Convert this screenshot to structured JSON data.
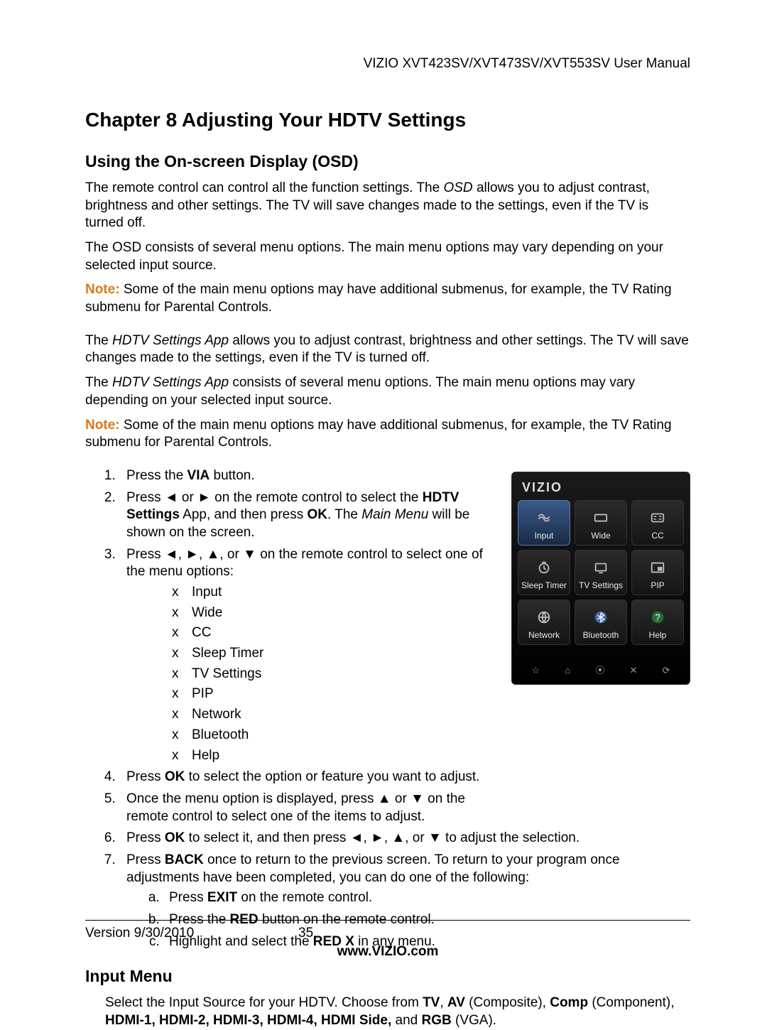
{
  "header": {
    "product_line": "VIZIO XVT423SV/XVT473SV/XVT553SV User Manual"
  },
  "chapter": {
    "number": "Chapter 8",
    "title": "Adjusting Your HDTV Settings"
  },
  "sections": {
    "osd": {
      "heading": "Using the On-screen Display (OSD)",
      "para1_a": "The remote control can control all the function settings. The ",
      "para1_osd": "OSD",
      "para1_b": " allows you to adjust contrast, brightness and other settings. The TV will save changes made to the settings, even if the TV is turned off.",
      "para2": "The OSD consists of several menu options. The main menu options may vary depending on your selected input source.",
      "note_label": "Note:",
      "note1_text": "  Some of the main menu options may have additional submenus, for example, the TV Rating submenu for Parental Controls.",
      "para3_a": "The ",
      "para3_app": "HDTV Settings App",
      "para3_b": " allows you to adjust contrast, brightness and other settings. The TV will save changes made to the settings, even if the TV is turned off.",
      "para4_a": "The ",
      "para4_app": "HDTV Settings App",
      "para4_b": " consists of several menu options. The main menu options may vary depending on your selected input source.",
      "note2_text": "  Some of the main menu options may have additional submenus, for example, the TV Rating submenu for Parental Controls."
    },
    "steps": {
      "s1_a": "Press the ",
      "s1_b": "VIA",
      "s1_c": " button.",
      "s2_a": "Press ◄ or ► on the remote control to select the ",
      "s2_b": "HDTV Settings",
      "s2_c": " App, and then press ",
      "s2_d": "OK",
      "s2_e": ". The ",
      "s2_f": "Main Menu",
      "s2_g": " will be shown on the screen.",
      "s3": "Press ◄, ►, ▲, or ▼ on the remote control to select one of the menu options:",
      "menu_options": [
        "Input",
        "Wide",
        "CC",
        "Sleep Timer",
        "TV Settings",
        "PIP",
        "Network",
        "Bluetooth",
        "Help"
      ],
      "s4_a": "Press ",
      "s4_b": "OK",
      "s4_c": " to select the option or feature you want to adjust.",
      "s5": "Once the menu option is displayed, press ▲ or ▼ on the remote control to select one of the items to adjust.",
      "s6_a": "Press ",
      "s6_b": "OK",
      "s6_c": " to select it, and then press ◄, ►, ▲, or ▼ to adjust the selection.",
      "s7_a": "Press ",
      "s7_b": "BACK",
      "s7_c": " once to return to the previous screen. To return to your program once adjustments have been completed, you can do one of the following:",
      "s7_sub_a_a": "Press ",
      "s7_sub_a_b": "EXIT",
      "s7_sub_a_c": " on the remote control.",
      "s7_sub_b_a": "Press the ",
      "s7_sub_b_b": "RED",
      "s7_sub_b_c": " button on the remote control.",
      "s7_sub_c_a": "Highlight and select the ",
      "s7_sub_c_b": "RED X",
      "s7_sub_c_c": " in any menu."
    },
    "input_menu": {
      "heading": "Input Menu",
      "line_a": "Select the Input Source for your HDTV. Choose from ",
      "tv": "TV",
      "sep1": ", ",
      "av": "AV",
      "av_paren": " (Composite), ",
      "comp": "Comp",
      "comp_paren": " (Component), ",
      "hdmi_list": "HDMI-1, HDMI-2, HDMI-3, HDMI-4, HDMI Side,",
      "and": " and ",
      "rgb": "RGB",
      "rgb_paren": " (VGA)."
    }
  },
  "device": {
    "brand": "VIZIO",
    "tiles": [
      {
        "label": "Input",
        "selected": true,
        "icon": "input-icon"
      },
      {
        "label": "Wide",
        "selected": false,
        "icon": "wide-icon"
      },
      {
        "label": "CC",
        "selected": false,
        "icon": "cc-icon"
      },
      {
        "label": "Sleep Timer",
        "selected": false,
        "icon": "clock-icon"
      },
      {
        "label": "TV Settings",
        "selected": false,
        "icon": "tv-icon"
      },
      {
        "label": "PIP",
        "selected": false,
        "icon": "pip-icon"
      },
      {
        "label": "Network",
        "selected": false,
        "icon": "globe-icon"
      },
      {
        "label": "Bluetooth",
        "selected": false,
        "icon": "bluetooth-icon"
      },
      {
        "label": "Help",
        "selected": false,
        "icon": "help-icon"
      }
    ],
    "dock": [
      "☆",
      "⌂",
      "⦿",
      "✕",
      "⟳"
    ]
  },
  "footer": {
    "version": "Version 9/30/2010",
    "page": "35",
    "url": "www.VIZIO.com"
  }
}
